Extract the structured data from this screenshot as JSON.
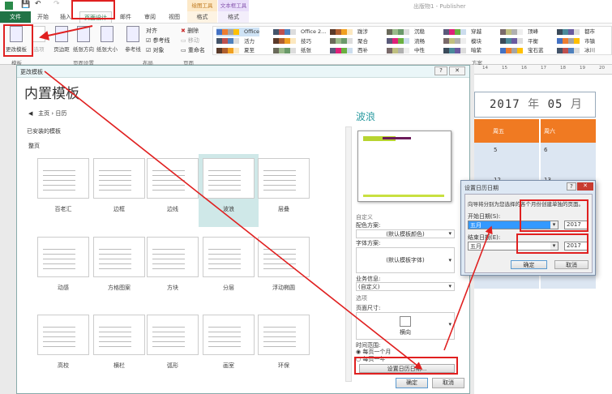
{
  "app": {
    "title": "出版物1 - Publisher"
  },
  "tabs": [
    "文件",
    "开始",
    "插入",
    "页面设计",
    "邮件",
    "审阅",
    "视图"
  ],
  "context_tabs": [
    {
      "group": "绘图工具",
      "tab": "格式",
      "color": "#f0a030"
    },
    {
      "group": "文本框工具",
      "tab": "格式",
      "color": "#8a5ab0"
    }
  ],
  "ribbon": {
    "change_template": "更改模板",
    "options": "选项",
    "margins": "页边距",
    "orientation": "纸张方向",
    "size": "纸张大小",
    "guides": "参考线",
    "align_label": "对齐",
    "guides_check": "参考线",
    "objects_check": "对象",
    "delete": "删除",
    "move": "移动",
    "rename": "重命名",
    "groups": [
      "模板",
      "页面设置",
      "布局",
      "页面",
      "方案"
    ],
    "schemes": [
      [
        "Office",
        "活力",
        "夏至"
      ],
      [
        "Office 2...",
        "技巧",
        "纸张"
      ],
      [
        "跋涉",
        "聚合",
        "西补"
      ],
      [
        "沉稳",
        "流畅",
        "中性"
      ],
      [
        "穿越",
        "模块",
        "暗紫"
      ],
      [
        "顶峰",
        "平衡",
        "宝石蓝"
      ],
      [
        "都市",
        "市镇",
        "冰川"
      ]
    ]
  },
  "dialog": {
    "title": "更改模板",
    "heading": "内置模板",
    "breadcrumb_home": "主页",
    "breadcrumb_sep": "›",
    "breadcrumb_current": "日历",
    "installed": "已安装的模板",
    "section": "整页",
    "templates": [
      "百老汇",
      "边框",
      "边线",
      "波浪",
      "层叠",
      "动感",
      "方格图案",
      "方块",
      "分层",
      "浮动椭圆",
      "高校",
      "横栏",
      "弧形",
      "画室",
      "环保"
    ],
    "selected": "波浪",
    "custom": "自定义",
    "color_scheme_label": "配色方案:",
    "color_scheme": "(默认模板颜色)",
    "font_scheme_label": "字体方案:",
    "font_scheme": "(默认模板字体)",
    "business_label": "业务信息:",
    "business": "(自定义)",
    "options": "选项",
    "page_size_label": "页面尺寸:",
    "page_size": "横向",
    "range_label": "时间范围:",
    "range_month": "每页一个月",
    "range_year": "每页一年",
    "set_dates": "设置日历日期...",
    "ok": "确定",
    "cancel": "取消"
  },
  "calendar": {
    "year": "2017",
    "year_unit": "年",
    "month": "05",
    "month_unit": "月",
    "headers": [
      "周五",
      "周六"
    ],
    "row1": [
      "5",
      "6"
    ],
    "row2": [
      "12",
      "13"
    ],
    "ruler": [
      "14",
      "15",
      "16",
      "17",
      "18",
      "19",
      "20"
    ],
    "header_color": "#f07a22"
  },
  "date_dialog": {
    "title": "设置日历日期",
    "desc": "向导将分别为您选择的各个月份创建单独的页面。",
    "start_label": "开始日期(S):",
    "start_month": "五月",
    "start_year": "2017",
    "end_label": "结束日期(E):",
    "end_month": "五月",
    "end_year": "2017",
    "ok": "确定",
    "cancel": "取消"
  }
}
